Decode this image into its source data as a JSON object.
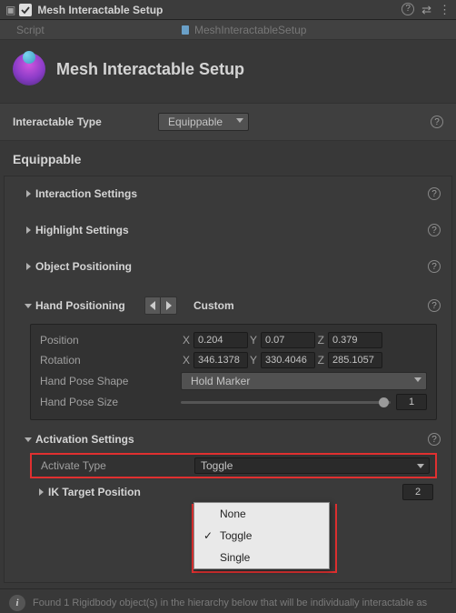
{
  "titlebar": {
    "title": "Mesh Interactable Setup"
  },
  "script": {
    "label": "Script",
    "value": "MeshInteractableSetup"
  },
  "header": {
    "title": "Mesh Interactable Setup"
  },
  "interactable": {
    "label": "Interactable Type",
    "value": "Equippable"
  },
  "equippable": {
    "title": "Equippable"
  },
  "sections": {
    "interaction": "Interaction Settings",
    "highlight": "Highlight Settings",
    "objpos": "Object Positioning",
    "handpos": "Hand Positioning",
    "activation": "Activation Settings",
    "ik": "IK Target Position"
  },
  "handpos": {
    "custom": "Custom",
    "position": {
      "label": "Position",
      "x": "0.204",
      "y": "0.07",
      "z": "0.379"
    },
    "rotation": {
      "label": "Rotation",
      "x": "346.1378",
      "y": "330.4046",
      "z": "285.1057"
    },
    "shape": {
      "label": "Hand Pose Shape",
      "value": "Hold Marker"
    },
    "size": {
      "label": "Hand Pose Size",
      "value": "1"
    }
  },
  "activate": {
    "label": "Activate Type",
    "value": "Toggle"
  },
  "popup": {
    "items": [
      "None",
      "Toggle",
      "Single"
    ],
    "checked": 1
  },
  "ik": {
    "value": "2"
  },
  "footer": {
    "text": "Found 1 Rigidbody object(s) in the hierarchy below that will be individually interactable as"
  }
}
